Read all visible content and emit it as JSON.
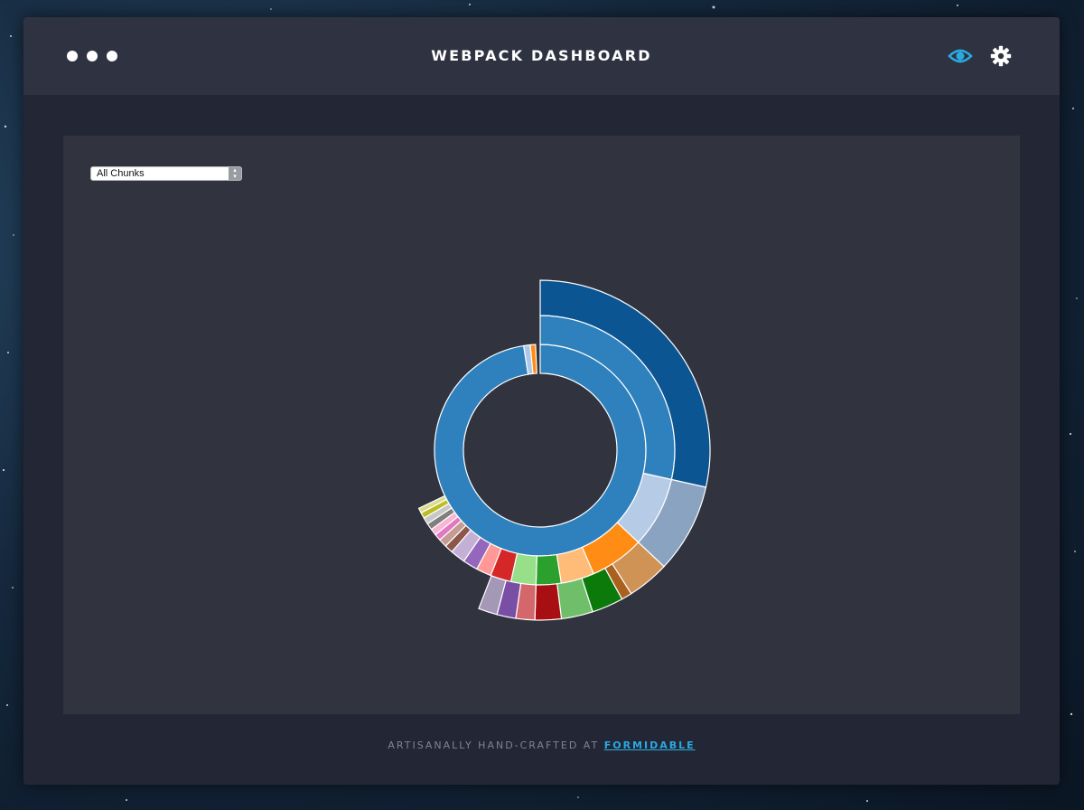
{
  "app": {
    "title": "WEBPACK DASHBOARD",
    "window_controls": [
      "dot",
      "dot",
      "dot"
    ],
    "icons": {
      "eye": "eye-icon",
      "settings": "gear-icon"
    },
    "accent_color": "#29aae1"
  },
  "chunk_select": {
    "selected": "All Chunks"
  },
  "footer": {
    "text": "ARTISANALLY HAND-CRAFTED AT",
    "link_label": "FORMIDABLE"
  },
  "chart_data": {
    "type": "sunburst",
    "rings": [
      {
        "ring": 1,
        "segments": [
          {
            "color": "#2f81bd",
            "span": 0.975
          },
          {
            "color": "#aec7e8",
            "span": 0.01
          },
          {
            "color": "#ff8c14",
            "span": 0.008
          }
        ]
      },
      {
        "ring": 2,
        "segments": [
          {
            "color": "#2f81bd",
            "span": 0.285
          },
          {
            "color": "#b6cbe6",
            "span": 0.085
          },
          {
            "color": "#ff8c14",
            "span": 0.065
          },
          {
            "color": "#ffbb78",
            "span": 0.04
          },
          {
            "color": "#2ca02c",
            "span": 0.03
          },
          {
            "color": "#98df8a",
            "span": 0.03
          },
          {
            "color": "#d62728",
            "span": 0.025
          },
          {
            "color": "#ff9896",
            "span": 0.018
          },
          {
            "color": "#9467bd",
            "span": 0.018
          },
          {
            "color": "#c5b0d5",
            "span": 0.018
          },
          {
            "color": "#8c564b",
            "span": 0.01
          },
          {
            "color": "#c49c94",
            "span": 0.01
          },
          {
            "color": "#e377c2",
            "span": 0.008
          },
          {
            "color": "#f7b6d2",
            "span": 0.008
          },
          {
            "color": "#7f7f7f",
            "span": 0.008
          },
          {
            "color": "#c7c7c7",
            "span": 0.008
          },
          {
            "color": "#bcbd22",
            "span": 0.007
          },
          {
            "color": "#dbdb8d",
            "span": 0.006
          }
        ]
      },
      {
        "ring": 3,
        "segments": [
          {
            "color": "#0b5592",
            "span": 0.285
          },
          {
            "color": "#8aa3c1",
            "span": 0.085
          },
          {
            "color": "#ce9355",
            "span": 0.04
          },
          {
            "color": "#a8611e",
            "span": 0.01
          },
          {
            "color": "#0b7a0b",
            "span": 0.03
          },
          {
            "color": "#6fbf6a",
            "span": 0.03
          },
          {
            "color": "#a80f12",
            "span": 0.025
          },
          {
            "color": "#d4676b",
            "span": 0.018
          },
          {
            "color": "#7b4ea5",
            "span": 0.018
          },
          {
            "color": "#a398b6",
            "span": 0.018
          }
        ]
      }
    ]
  }
}
